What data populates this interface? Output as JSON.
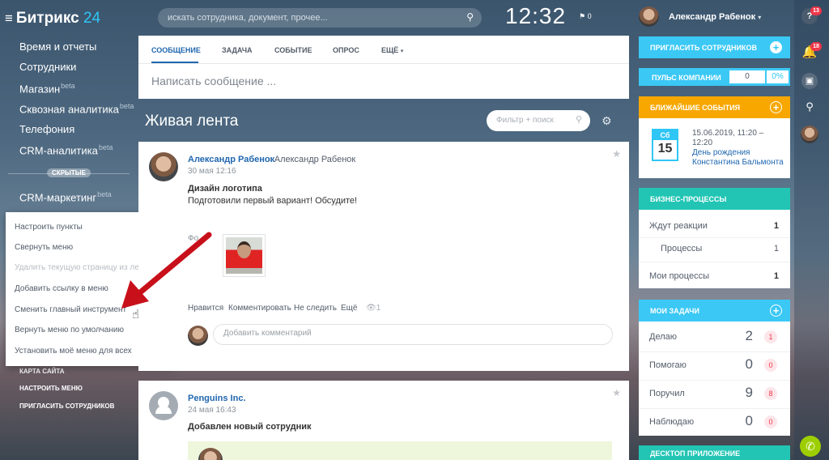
{
  "logo": {
    "burger": "≡",
    "brand": "Битрикс",
    "brand_num": "24"
  },
  "sidebar": {
    "items": [
      {
        "label": "Время и отчеты",
        "beta": ""
      },
      {
        "label": "Сотрудники",
        "beta": ""
      },
      {
        "label": "Магазин",
        "beta": "beta"
      },
      {
        "label": "Сквозная аналитика",
        "beta": "beta"
      },
      {
        "label": "Телефония",
        "beta": ""
      },
      {
        "label": "CRM-аналитика",
        "beta": "beta"
      },
      {
        "label": "CRM-маркетинг",
        "beta": "beta"
      }
    ],
    "hidden_label": "СКРЫТЫЕ",
    "bottom_links": [
      "КАРТА САЙТА",
      "НАСТРОИТЬ МЕНЮ",
      "ПРИГЛАСИТЬ СОТРУДНИКОВ"
    ]
  },
  "context_menu": {
    "items": [
      {
        "label": "Настроить пункты",
        "disabled": false
      },
      {
        "label": "Свернуть меню",
        "disabled": false
      },
      {
        "label": "Удалить текущую страницу из левого меню",
        "disabled": true
      },
      {
        "label": "Добавить ссылку в меню",
        "disabled": false
      },
      {
        "label": "Сменить главный инструмент",
        "disabled": false
      },
      {
        "label": "Вернуть меню по умолчанию",
        "disabled": false
      },
      {
        "label": "Установить моё меню для всех",
        "disabled": false
      }
    ]
  },
  "topbar": {
    "search_placeholder": "искать сотрудника, документ, прочее...",
    "clock": "12:32",
    "flag_count": "0",
    "user_name": "Александр Рабенок",
    "user_caret": "▾"
  },
  "rail": {
    "help_badge": "13",
    "bell_badge": "18"
  },
  "composer": {
    "tabs": [
      "СООБЩЕНИЕ",
      "ЗАДАЧА",
      "СОБЫТИЕ",
      "ОПРОС",
      "ЕЩЁ"
    ],
    "more_caret": "▾",
    "placeholder": "Написать сообщение ..."
  },
  "feed": {
    "title": "Живая лента",
    "filter_placeholder": "Фильтр + поиск"
  },
  "posts": [
    {
      "author": "Александр Рабенок",
      "target": "Александр Рабенок",
      "date": "30 мая 12:16",
      "title": "Дизайн логотипа",
      "text": "Подготовили первый вариант! Обсудите!",
      "photo_label": "Фо",
      "actions": [
        "Нравится",
        "Комментировать",
        "Не следить",
        "Ещё"
      ],
      "views": "1",
      "comment_placeholder": "Добавить комментарий"
    },
    {
      "author": "Penguins Inc.",
      "date": "24 мая 16:43",
      "title": "Добавлен новый сотрудник"
    }
  ],
  "widgets": {
    "invite": "ПРИГЛАСИТЬ СОТРУДНИКОВ",
    "pulse": {
      "title": "ПУЛЬС КОМПАНИИ",
      "value": "0",
      "percent": "0%"
    },
    "events": {
      "title": "БЛИЖАЙШИЕ СОБЫТИЯ",
      "day": "Сб",
      "num": "15",
      "date": "15.06.2019, 11:20 – 12:20",
      "name": "День рождения Константина Бальмонта"
    },
    "bp": {
      "title": "БИЗНЕС-ПРОЦЕССЫ",
      "rows": [
        {
          "label": "Ждут реакции",
          "value": "1"
        },
        {
          "label": "Процессы",
          "value": "1"
        },
        {
          "label": "Мои процессы",
          "value": "1"
        }
      ]
    },
    "tasks": {
      "title": "МОИ ЗАДАЧИ",
      "rows": [
        {
          "label": "Делаю",
          "value": "2",
          "badge": "1"
        },
        {
          "label": "Помогаю",
          "value": "0",
          "badge": "0"
        },
        {
          "label": "Поручил",
          "value": "9",
          "badge": "8"
        },
        {
          "label": "Наблюдаю",
          "value": "0",
          "badge": "0"
        }
      ]
    },
    "desktop": "ДЕСКТОП ПРИЛОЖЕНИЕ"
  },
  "colors": {
    "accent_blue": "#2067b0",
    "cyan": "#3bc8f5",
    "orange": "#f7a700",
    "teal": "#22c5b4",
    "arrow_red": "#d0121b",
    "badge_red": "#f0364a"
  }
}
